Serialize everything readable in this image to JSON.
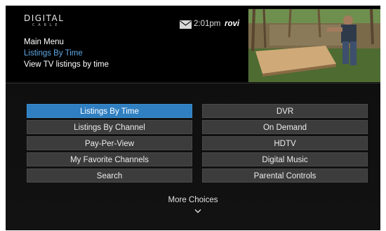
{
  "brand": {
    "logo_top": "DIGITAL",
    "logo_bottom": "CABLE",
    "partner": "rovi"
  },
  "status": {
    "time": "2:01pm",
    "mail_icon": "mail-icon"
  },
  "breadcrumb": {
    "menu": "Main Menu",
    "selection": "Listings By Time",
    "description": "View TV listings by time"
  },
  "colors": {
    "accent": "#2f7fc1",
    "highlight_text": "#5fa9e6",
    "button_bg": "#3c3c3c"
  },
  "menu": {
    "left": [
      "Listings By Time",
      "Listings By Channel",
      "Pay-Per-View",
      "My Favorite Channels",
      "Search"
    ],
    "right": [
      "DVR",
      "On Demand",
      "HDTV",
      "Digital Music",
      "Parental Controls"
    ],
    "selected": "Listings By Time"
  },
  "footer": {
    "more_label": "More Choices",
    "more_icon": "chevron-down-icon"
  }
}
